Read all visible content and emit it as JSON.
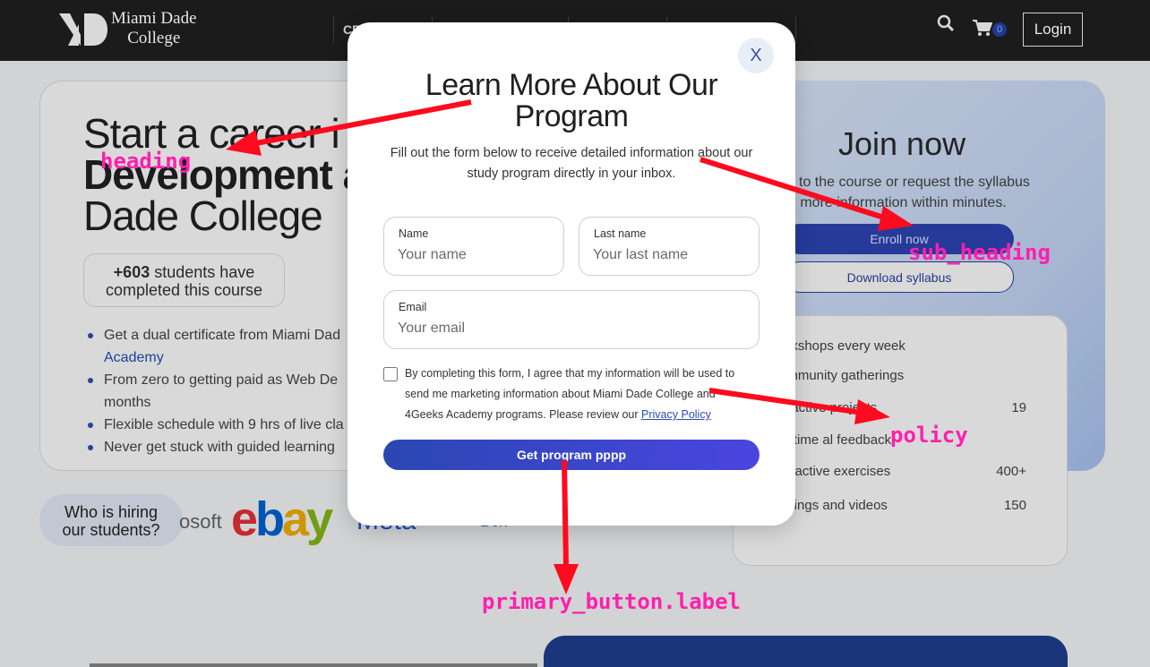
{
  "header": {
    "brand_line1": "Miami Dade",
    "brand_line2": "College",
    "nav_items": [
      "CE",
      "",
      "",
      "",
      ""
    ],
    "cart_count": "0",
    "login_label": "Login"
  },
  "hero": {
    "title_line1": "Start a career i",
    "title_line2": "Development a",
    "title_line3": "Dade College",
    "students_count": "+603",
    "students_line1": "students have",
    "students_line2": "completed this course",
    "bullets": [
      "Get a dual certificate from Miami Dad",
      "Academy",
      "From zero to getting paid as Web De",
      "months",
      "Flexible schedule with 9 hrs of live cla",
      "Never get stuck with guided learning"
    ]
  },
  "hiring": {
    "label_line1": "Who is hiring",
    "label_line2": "our students?",
    "logos": [
      "osoft",
      "ebay",
      "Meta",
      "Bck"
    ]
  },
  "join": {
    "title": "Join now",
    "subtitle_line1": "to the course or request the syllabus",
    "subtitle_line2": "d more information within minutes.",
    "enroll_label": "Enroll now",
    "syllabus_label": "Download syllabus",
    "stats": [
      {
        "label": "orkshops every week",
        "value": ""
      },
      {
        "label": "ommunity gatherings",
        "value": ""
      },
      {
        "label": "eractive projects",
        "value": "19"
      },
      {
        "label": "al time al feedback",
        "value": ""
      },
      {
        "label": "teractive exercises",
        "value": "400+"
      },
      {
        "label": "adings and videos",
        "value": "150"
      }
    ]
  },
  "modal": {
    "close_label": "X",
    "title_line1": "Learn More About Our",
    "title_line2": "Program",
    "subtitle_line1": "Fill out the form below to receive detailed information about our",
    "subtitle_line2": "study program directly in your inbox.",
    "fields": {
      "name": {
        "label": "Name",
        "value": "",
        "placeholder": "Your name"
      },
      "last_name": {
        "label": "Last name",
        "value": "",
        "placeholder": "Your last name"
      },
      "email": {
        "label": "Email",
        "value": "",
        "placeholder": "Your email"
      }
    },
    "consent_line1": "By completing this form, I agree that my information will be used to",
    "consent_line2": "send me marketing information about Miami Dade College and",
    "consent_line3": "4Geeks Academy programs. Please review our",
    "policy_link": "Privacy Policy",
    "primary_button_label": "Get program pppp"
  },
  "annotations": {
    "heading": "heading",
    "sub_heading": "sub_heading",
    "policy": "policy",
    "primary_button": "primary_button.label"
  },
  "colors": {
    "annotation": "#ff1fae",
    "arrow": "#ff0a1e",
    "primary_start": "#2b47b2",
    "primary_end": "#4a45e0"
  }
}
